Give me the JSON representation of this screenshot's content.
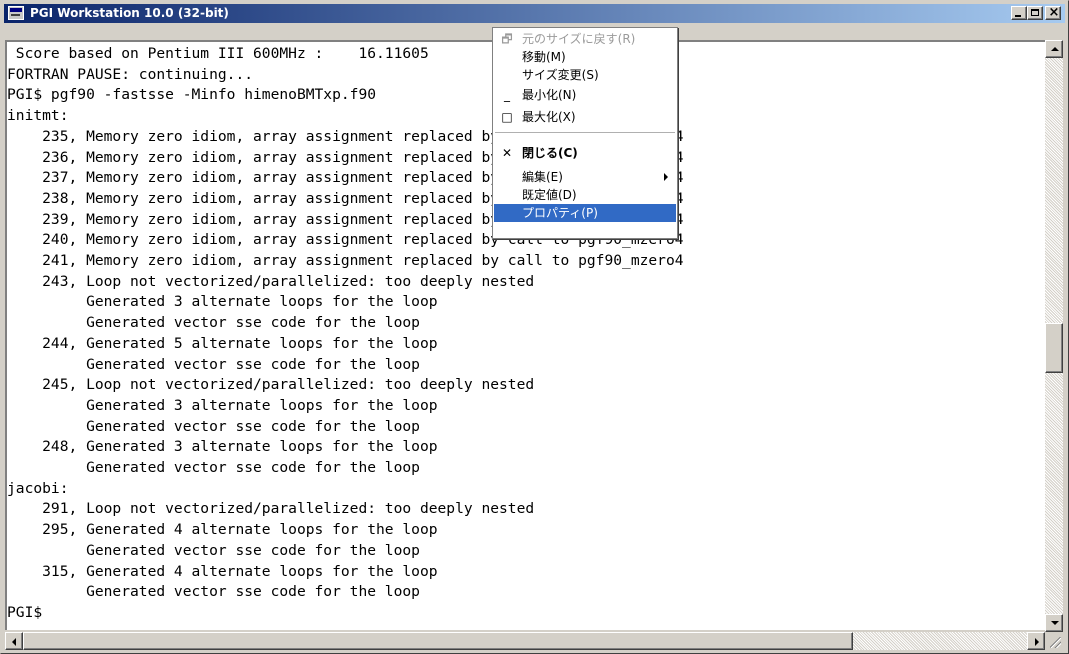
{
  "window": {
    "title": "PGI Workstation 10.0 (32-bit)"
  },
  "console_lines": [
    " Score based on Pentium III 600MHz :    16.11605",
    "FORTRAN PAUSE: continuing...",
    "PGI$ pgf90 -fastsse -Minfo himenoBMTxp.f90",
    "initmt:",
    "    235, Memory zero idiom, array assignment replaced by call to pgf90_mzero4",
    "    236, Memory zero idiom, array assignment replaced by call to pgf90_mzero4",
    "    237, Memory zero idiom, array assignment replaced by call to pgf90_mzero4",
    "    238, Memory zero idiom, array assignment replaced by call to pgf90_mzero4",
    "    239, Memory zero idiom, array assignment replaced by call to pgf90_mzero4",
    "    240, Memory zero idiom, array assignment replaced by call to pgf90_mzero4",
    "    241, Memory zero idiom, array assignment replaced by call to pgf90_mzero4",
    "    243, Loop not vectorized/parallelized: too deeply nested",
    "         Generated 3 alternate loops for the loop",
    "         Generated vector sse code for the loop",
    "    244, Generated 5 alternate loops for the loop",
    "         Generated vector sse code for the loop",
    "    245, Loop not vectorized/parallelized: too deeply nested",
    "         Generated 3 alternate loops for the loop",
    "         Generated vector sse code for the loop",
    "    248, Generated 3 alternate loops for the loop",
    "         Generated vector sse code for the loop",
    "jacobi:",
    "    291, Loop not vectorized/parallelized: too deeply nested",
    "    295, Generated 4 alternate loops for the loop",
    "         Generated vector sse code for the loop",
    "    315, Generated 4 alternate loops for the loop",
    "         Generated vector sse code for the loop",
    "PGI$"
  ],
  "context_menu": {
    "items": [
      {
        "label": "元のサイズに戻す(R)",
        "icon": "restore-icon",
        "icon_glyph": "🗗",
        "state": "disabled"
      },
      {
        "label": "移動(M)",
        "icon": "",
        "icon_glyph": "",
        "state": "normal"
      },
      {
        "label": "サイズ変更(S)",
        "icon": "",
        "icon_glyph": "",
        "state": "normal"
      },
      {
        "label": "最小化(N)",
        "icon": "minimize-icon",
        "icon_glyph": "_",
        "state": "normal"
      },
      {
        "label": "最大化(X)",
        "icon": "maximize-icon",
        "icon_glyph": "□",
        "state": "normal"
      },
      {
        "label": "閉じる(C)",
        "icon": "close-icon",
        "icon_glyph": "✕",
        "state": "bold"
      },
      {
        "label": "編集(E)",
        "icon": "",
        "icon_glyph": "",
        "state": "submenu"
      },
      {
        "label": "既定値(D)",
        "icon": "",
        "icon_glyph": "",
        "state": "normal"
      },
      {
        "label": "プロパティ(P)",
        "icon": "",
        "icon_glyph": "",
        "state": "selected"
      }
    ]
  },
  "colors": {
    "titlebar_start": "#0a246a",
    "titlebar_end": "#a6caf0",
    "menu_highlight": "#316ac5",
    "console_bg": "#ffffff",
    "console_text": "#000000"
  }
}
